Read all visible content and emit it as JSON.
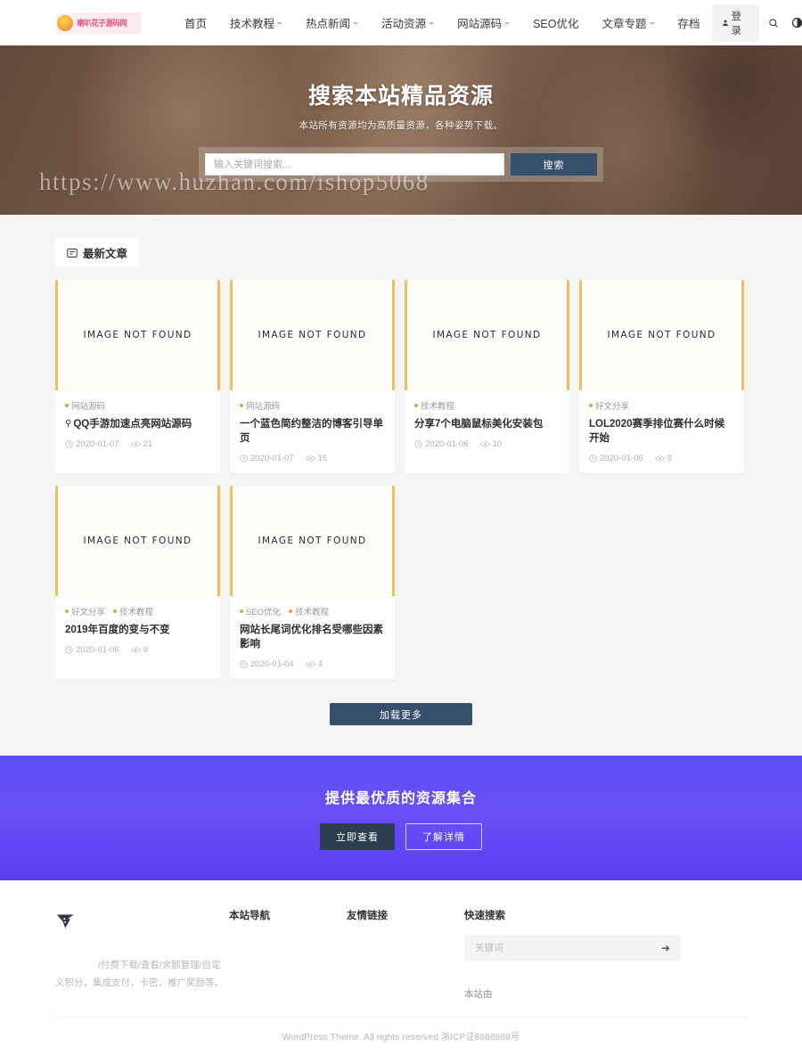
{
  "header": {
    "logo_text": "喇叭花子源码网",
    "nav": [
      {
        "label": "首页",
        "has_caret": false
      },
      {
        "label": "技术教程",
        "has_caret": true
      },
      {
        "label": "热点新闻",
        "has_caret": true
      },
      {
        "label": "活动资源",
        "has_caret": true
      },
      {
        "label": "网站源码",
        "has_caret": true
      },
      {
        "label": "SEO优化",
        "has_caret": false
      },
      {
        "label": "文章专题",
        "has_caret": true
      },
      {
        "label": "存档",
        "has_caret": false
      }
    ],
    "login_label": "登录",
    "icons": [
      "search-icon",
      "contrast-icon",
      "menu-icon"
    ]
  },
  "hero": {
    "title": "搜索本站精品资源",
    "subtitle": "本站所有资源均为高质量资源，各种姿势下载。",
    "search_placeholder": "输入关键词搜索...",
    "search_button": "搜索",
    "watermark": "https://www.huzhan.com/ishop5068"
  },
  "main": {
    "section_title": "最新文章",
    "placeholder_text": "IMAGE NOT FOUND",
    "load_more": "加载更多",
    "cards": [
      {
        "cats": [
          "网站源码"
        ],
        "title": "QQ手游加速点亮网站源码",
        "pinned": true,
        "date": "2020-01-07",
        "views": "21"
      },
      {
        "cats": [
          "网站源码"
        ],
        "title": "一个蓝色简约整洁的博客引导单页",
        "pinned": false,
        "date": "2020-01-07",
        "views": "15"
      },
      {
        "cats": [
          "技术教程"
        ],
        "title": "分享7个电脑鼠标美化安装包",
        "pinned": false,
        "date": "2020-01-06",
        "views": "10"
      },
      {
        "cats": [
          "好文分享"
        ],
        "title": "LOL2020赛季排位赛什么时候开始",
        "pinned": false,
        "date": "2020-01-06",
        "views": "8"
      },
      {
        "cats": [
          "好文分享",
          "技术教程"
        ],
        "title": "2019年百度的变与不变",
        "pinned": false,
        "date": "2020-01-06",
        "views": "9"
      },
      {
        "cats": [
          "SEO优化",
          "技术教程"
        ],
        "title": "网站长尾词优化排名受哪些因素影响",
        "pinned": false,
        "date": "2020-01-04",
        "views": "4"
      }
    ]
  },
  "cta": {
    "title": "提供最优质的资源集合",
    "primary_button": "立即查看",
    "secondary_button": "了解详情"
  },
  "footer": {
    "desc_line1": "/付费下载/查看/余额管理/自定",
    "desc_line2": "义积分，集成支付，卡密，推广奖励等。",
    "nav_title": "本站导航",
    "links_title": "友情链接",
    "search_title": "快速搜索",
    "search_placeholder": "关键词",
    "note": "本站由",
    "copyright": "WordPress Theme. All rights reserved 浙ICP证8888888号"
  },
  "colors": {
    "accent_blue": "#36506b",
    "cta_purple": "#5b4ef5",
    "thumb_border": "#e8c25e",
    "logo_pink": "#e4567e"
  }
}
